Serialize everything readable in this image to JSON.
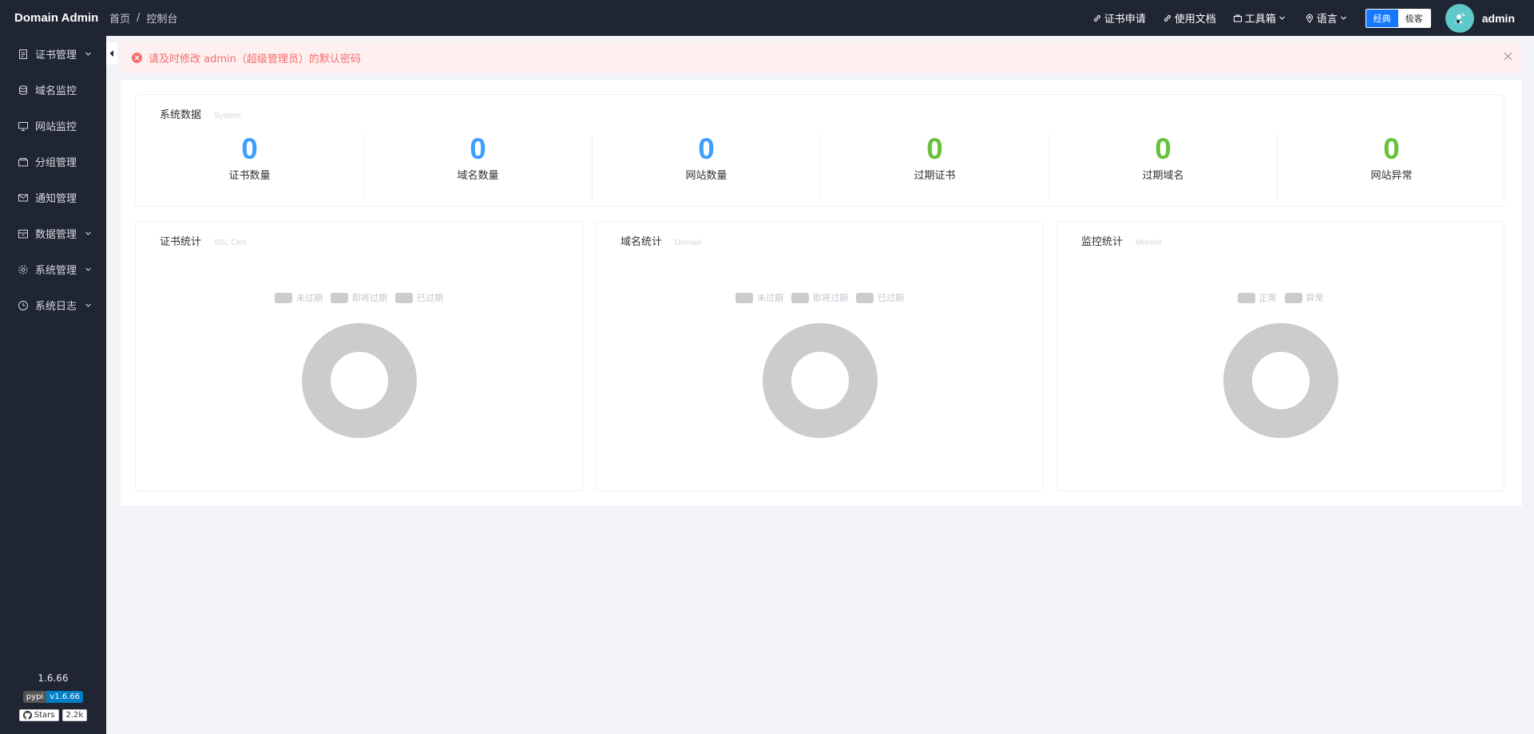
{
  "header": {
    "brand": "Domain Admin",
    "breadcrumb": [
      "首页",
      "控制台"
    ],
    "links": [
      {
        "label": "证书申请",
        "icon": "link-icon"
      },
      {
        "label": "使用文档",
        "icon": "link-icon"
      },
      {
        "label": "工具箱",
        "icon": "toolbox-icon"
      },
      {
        "label": "语言",
        "icon": "location-icon"
      }
    ],
    "theme_options": [
      "经典",
      "极客"
    ],
    "user": "admin"
  },
  "sidebar": {
    "items": [
      {
        "label": "证书管理",
        "icon": "document-icon",
        "has_submenu": true
      },
      {
        "label": "域名监控",
        "icon": "database-icon",
        "has_submenu": false
      },
      {
        "label": "网站监控",
        "icon": "monitor-icon",
        "has_submenu": false
      },
      {
        "label": "分组管理",
        "icon": "folder-icon",
        "has_submenu": false
      },
      {
        "label": "通知管理",
        "icon": "mail-icon",
        "has_submenu": false
      },
      {
        "label": "数据管理",
        "icon": "box-icon",
        "has_submenu": true
      },
      {
        "label": "系统管理",
        "icon": "gear-icon",
        "has_submenu": true
      },
      {
        "label": "系统日志",
        "icon": "clock-icon",
        "has_submenu": true
      }
    ],
    "version": "1.6.66",
    "pypi_badge": {
      "left": "pypi",
      "right": "v1.6.66"
    },
    "github_badge": {
      "left": "Stars",
      "right": "2.2k"
    }
  },
  "alert": {
    "message": "请及时修改 admin（超级管理员）的默认密码"
  },
  "system_card": {
    "title": "系统数据",
    "subtitle": "System",
    "stats": [
      {
        "value": "0",
        "label": "证书数量",
        "color": "#409eff"
      },
      {
        "value": "0",
        "label": "域名数量",
        "color": "#409eff"
      },
      {
        "value": "0",
        "label": "网站数量",
        "color": "#409eff"
      },
      {
        "value": "0",
        "label": "过期证书",
        "color": "#67c23a"
      },
      {
        "value": "0",
        "label": "过期域名",
        "color": "#67c23a"
      },
      {
        "value": "0",
        "label": "网站异常",
        "color": "#67c23a"
      }
    ]
  },
  "charts": [
    {
      "title": "证书统计",
      "subtitle": "SSL Cert",
      "legend": [
        "未过期",
        "即将过期",
        "已过期"
      ]
    },
    {
      "title": "域名统计",
      "subtitle": "Domain",
      "legend": [
        "未过期",
        "即将过期",
        "已过期"
      ]
    },
    {
      "title": "监控统计",
      "subtitle": "Monitor",
      "legend": [
        "正常",
        "异常"
      ]
    }
  ],
  "colors": {
    "sidebar_bg": "#1f2533",
    "primary": "#409eff",
    "success": "#67c23a",
    "danger": "#f56c6c",
    "empty_chart": "#cccccc"
  }
}
